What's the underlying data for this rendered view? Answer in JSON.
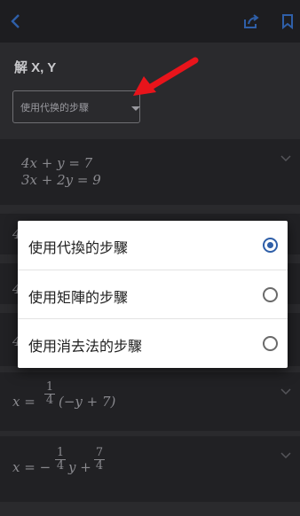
{
  "header": {
    "back_icon": "chevron-left-icon",
    "share_icon": "share-icon",
    "bookmark_icon": "bookmark-icon"
  },
  "problem": {
    "title": "解 X, Y",
    "method_select_value": "使用代换的步驟"
  },
  "rows": [
    {
      "lines": [
        "4x + y = 7",
        "3x + 2y = 9"
      ]
    },
    {
      "lines": [
        "4"
      ]
    },
    {
      "lines": [
        "4"
      ]
    },
    {
      "lines": [
        "4"
      ]
    },
    {
      "lines": [
        "x = 1/4 (−y + 7)"
      ],
      "lhs": "x =",
      "frac_num": "1",
      "frac_den": "4",
      "rhs": "(−y + 7)"
    },
    {
      "lines": [
        "x = −1/4 y + 7/4"
      ],
      "lhs": "x = −",
      "frac_num": "1",
      "frac_den": "4",
      "mid": "y +",
      "frac2_num": "7",
      "frac2_den": "4"
    }
  ],
  "dialog": {
    "options": [
      {
        "label": "使用代換的步驟",
        "selected": true
      },
      {
        "label": "使用矩陣的步驟",
        "selected": false
      },
      {
        "label": "使用消去法的步驟",
        "selected": false
      }
    ]
  },
  "colors": {
    "accent": "#2f5fa8",
    "annotation_arrow": "#e8141b",
    "header_icons": "#2f5fa8"
  }
}
